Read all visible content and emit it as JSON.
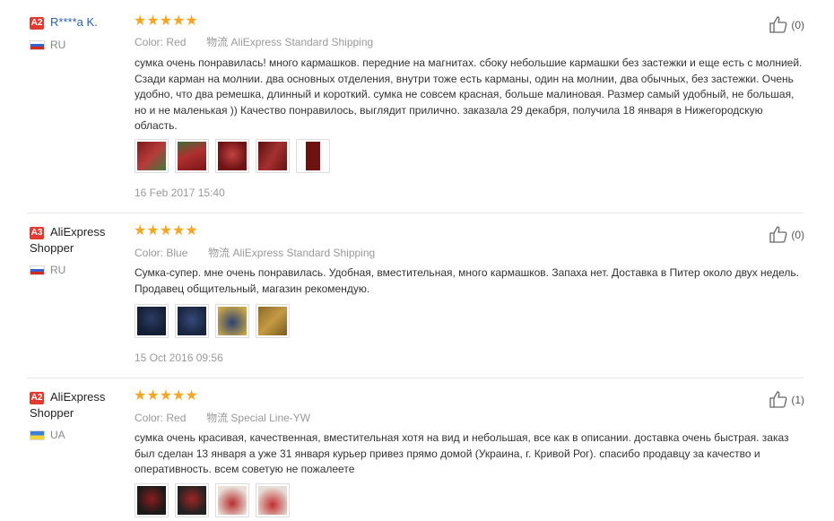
{
  "reviews": [
    {
      "level": "A2",
      "name": "R****a K.",
      "country": "RU",
      "stars": "★★★★★",
      "color_label": "Color:",
      "color_value": "Red",
      "ship_label": "物流",
      "ship_value": "AliExpress Standard Shipping",
      "text": "сумка очень понравилась! много кармашков. передние на магнитах. сбоку небольшие кармашки без застежки и еще есть с молнией. Сзади карман на молнии. два основных отделения, внутри тоже есть карманы, один на молнии, два обычных, без застежки. Очень удобно, что два ремешка, длинный и короткий. сумка не совсем красная, больше малиновая. Размер самый удобный, не большая, но и не маленькая )) Качество понравилось, выглядит прилично. заказала 29 декабря, получила 18 января в Нижегородскую область.",
      "date": "16 Feb 2017 15:40",
      "likes": "(0)"
    },
    {
      "level": "A3",
      "name": "AliExpress Shopper",
      "country": "RU",
      "stars": "★★★★★",
      "color_label": "Color:",
      "color_value": "Blue",
      "ship_label": "物流",
      "ship_value": "AliExpress Standard Shipping",
      "text": "Сумка-супер. мне очень понравилась. Удобная, вместительная, много кармашков. Запаха нет. Доставка в Питер около двух недель. Продавец общительный, магазин рекомендую.",
      "date": "15 Oct 2016 09:56",
      "likes": "(0)"
    },
    {
      "level": "A2",
      "name": "AliExpress Shopper",
      "country": "UA",
      "stars": "★★★★★",
      "color_label": "Color:",
      "color_value": "Red",
      "ship_label": "物流",
      "ship_value": "Special Line-YW",
      "text": "сумка очень красивая, качественная, вместительная хотя на вид и небольшая, все как в описании. доставка очень быстрая. заказ был сделан 13 января а уже 31 января курьер привез прямо домой (Украина, г. Кривой Рог). спасибо продавцу за качество и оперативность. всем советую не пожалеете",
      "likes": "(1)"
    }
  ],
  "colors": {
    "star": "#f5a623",
    "badge": "#e4392e",
    "link": "#2a62ad"
  }
}
